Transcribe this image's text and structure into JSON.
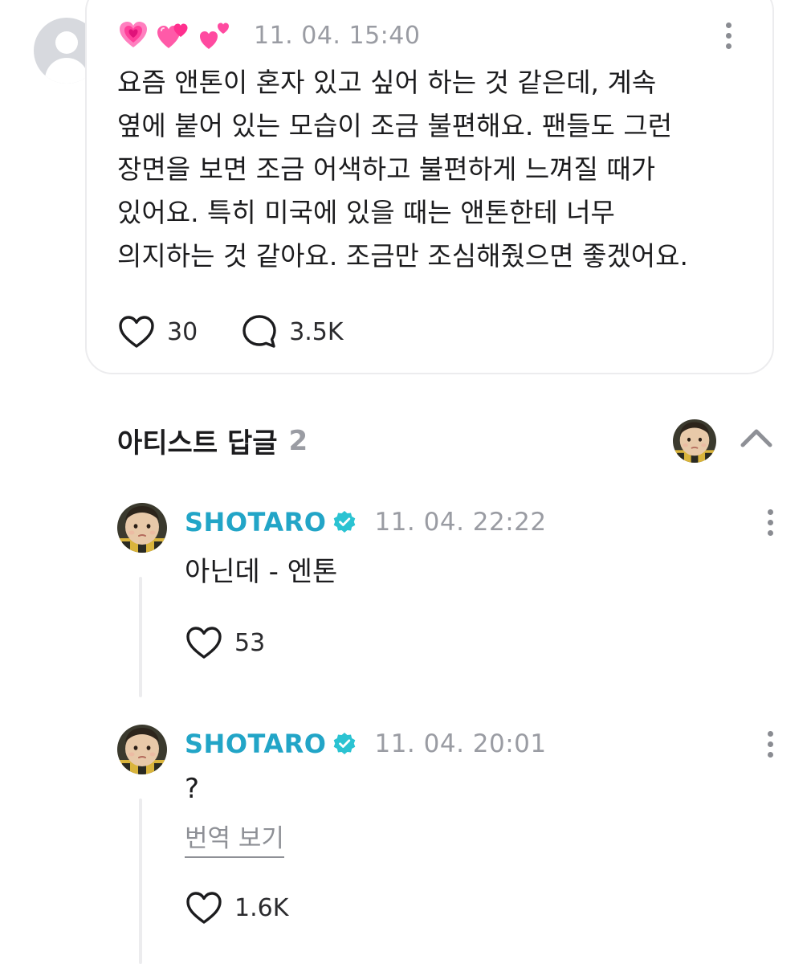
{
  "post": {
    "author_emojis": [
      "growing-heart",
      "two-hearts",
      "revolving-hearts"
    ],
    "timestamp": "11. 04. 15:40",
    "body_lines": [
      "요즘 앤톤이 혼자 있고 싶어 하는 것 같은데, 계속",
      "옆에 붙어 있는 모습이 조금 불편해요. 팬들도 그런",
      "장면을 보면 조금 어색하고 불편하게 느껴질 때가",
      "있어요. 특히 미국에 있을 때는 앤톤한테 너무",
      "의지하는 것 같아요. 조금만 조심해줬으면 좋겠어요."
    ],
    "like_count": "30",
    "comment_count": "3.5K"
  },
  "replies_section": {
    "title": "아티스트 답글",
    "count": "2"
  },
  "replies": [
    {
      "author": "SHOTARO",
      "timestamp": "11. 04. 22:22",
      "text": "아닌데 - 엔톤",
      "like_count": "53"
    },
    {
      "author": "SHOTARO",
      "timestamp": "11. 04. 20:01",
      "text": "?",
      "translate_label": "번역 보기",
      "like_count": "1.6K"
    }
  ],
  "colors": {
    "artist_name": "#22a5c7",
    "verified_badge": "#2bc3d2",
    "muted_text": "#9a9ca3",
    "card_border": "#ececee",
    "emoji_pink": "#ff4fa3"
  }
}
